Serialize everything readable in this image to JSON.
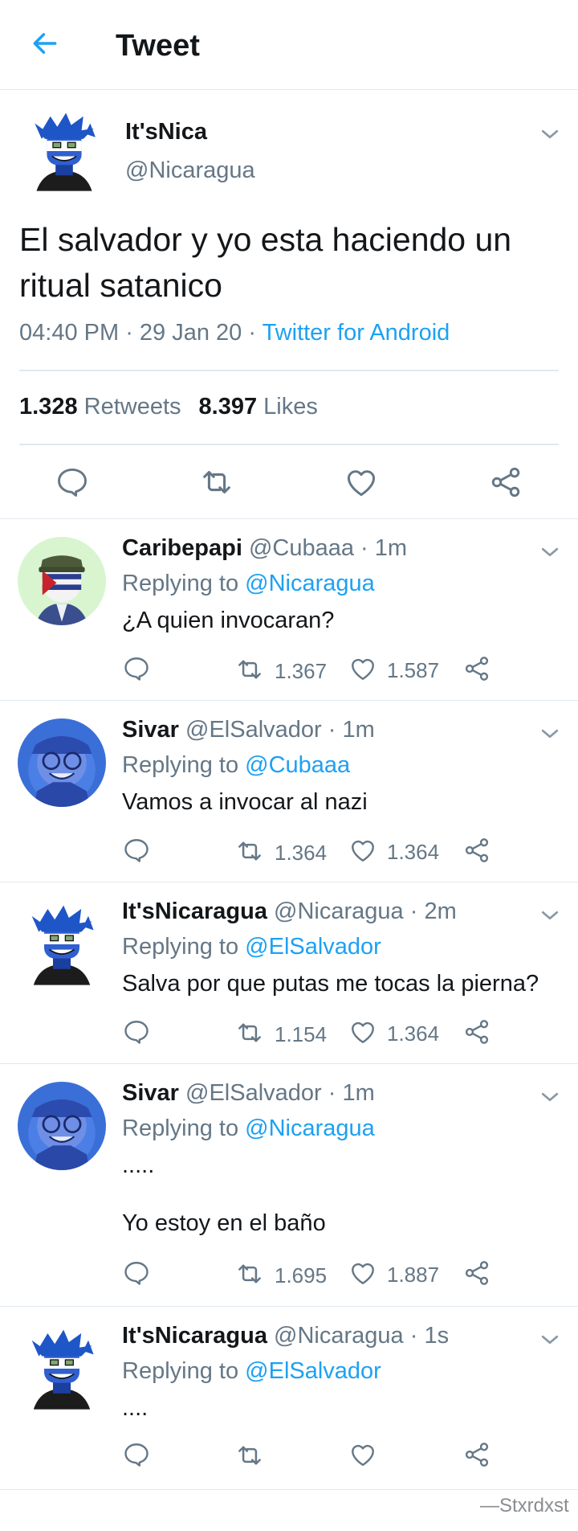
{
  "header": {
    "title": "Tweet",
    "back_icon": "arrow-left-icon"
  },
  "tweet": {
    "name": "It'sNica",
    "handle": "@Nicaragua",
    "text": "El salvador y yo esta haciendo un ritual satanico",
    "time": "04:40 PM",
    "date": "29 Jan 20",
    "source": "Twitter for Android",
    "retweets_count": "1.328",
    "retweets_label": "Retweets",
    "likes_count": "8.397",
    "likes_label": "Likes"
  },
  "replying_prefix": "Replying to",
  "replies": [
    {
      "name": "Caribepapi",
      "handle": "@Cubaaa",
      "time": "1m",
      "replying_to": "@Nicaragua",
      "text": "¿A quien invocaran?",
      "retweets": "1.367",
      "likes": "1.587"
    },
    {
      "name": "Sivar",
      "handle": "@ElSalvador",
      "time": "1m",
      "replying_to": "@Cubaaa",
      "text": "Vamos a invocar al nazi",
      "retweets": "1.364",
      "likes": "1.364"
    },
    {
      "name": "It'sNicaragua",
      "handle": "@Nicaragua",
      "time": "2m",
      "replying_to": "@ElSalvador",
      "text": "Salva por que putas me tocas la pierna?",
      "retweets": "1.154",
      "likes": "1.364"
    },
    {
      "name": "Sivar",
      "handle": "@ElSalvador",
      "time": "1m",
      "replying_to": "@Nicaragua",
      "text": ".....\n\nYo estoy en el baño",
      "retweets": "1.695",
      "likes": "1.887"
    },
    {
      "name": "It'sNicaragua",
      "handle": "@Nicaragua",
      "time": "1s",
      "replying_to": "@ElSalvador",
      "text": "....",
      "retweets": "",
      "likes": ""
    }
  ],
  "credit": "—Stxrdxst",
  "colors": {
    "accent": "#1da1f2",
    "secondary_text": "#657786",
    "divider": "#e1e8ed"
  }
}
